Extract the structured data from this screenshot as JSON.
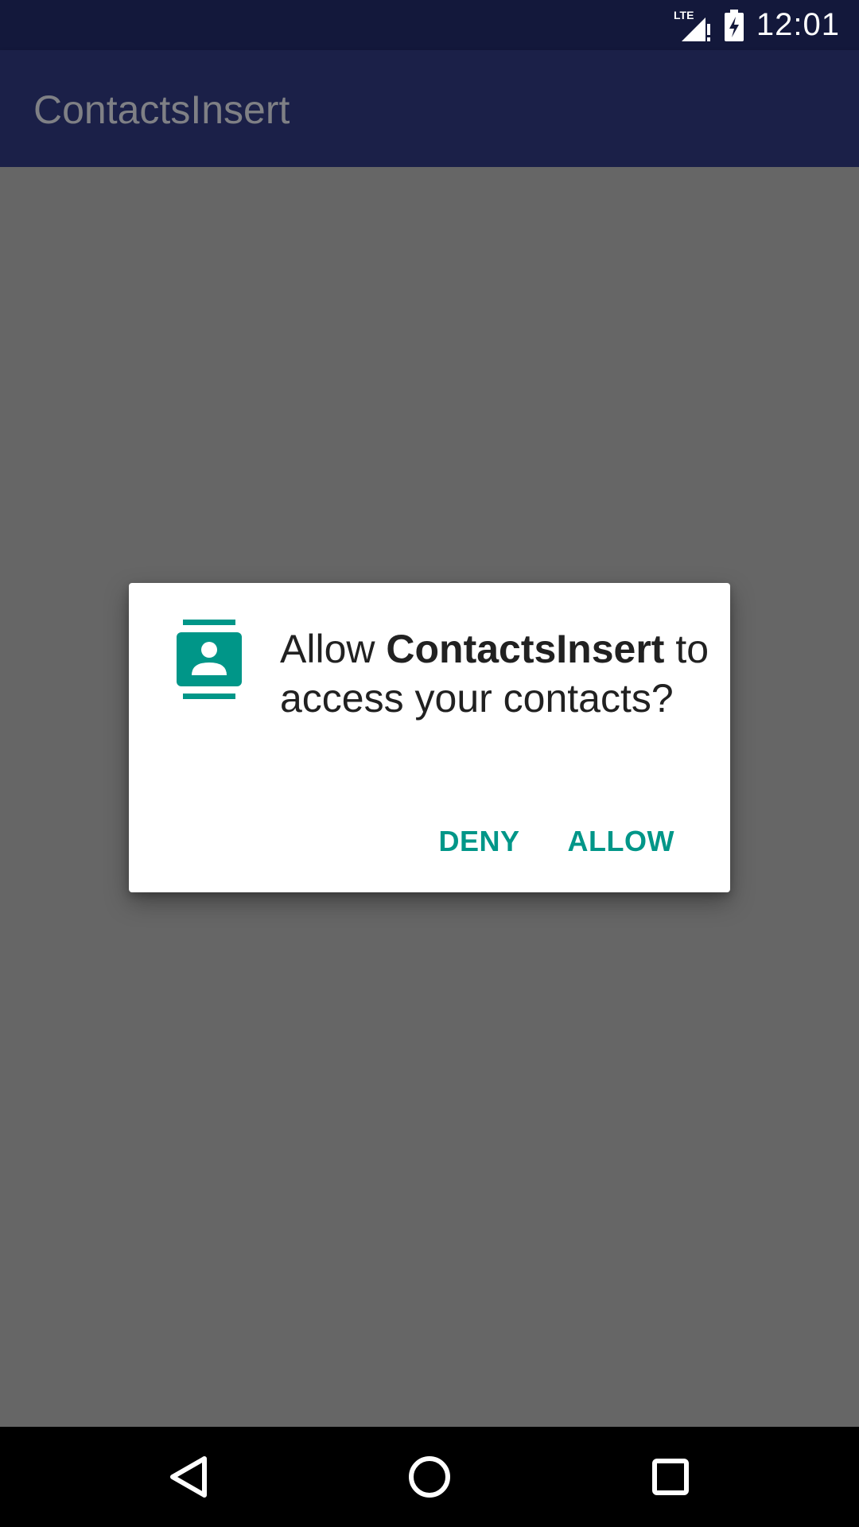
{
  "status_bar": {
    "network_label": "LTE",
    "time": "12:01",
    "icons": [
      "lte-signal-icon",
      "battery-charging-icon"
    ]
  },
  "app_bar": {
    "title": "ContactsInsert"
  },
  "dialog": {
    "icon": "contacts-icon",
    "message_prefix": "Allow ",
    "app_name": "ContactsInsert",
    "message_suffix": " to access your contacts?",
    "deny_label": "DENY",
    "allow_label": "ALLOW"
  },
  "nav_bar": {
    "icons": [
      "back-icon",
      "home-icon",
      "recents-icon"
    ]
  },
  "colors": {
    "status_bar": "#13183b",
    "app_bar": "#1b2048",
    "scrim": "#666666",
    "accent": "#009688",
    "dialog_text": "#212121"
  }
}
